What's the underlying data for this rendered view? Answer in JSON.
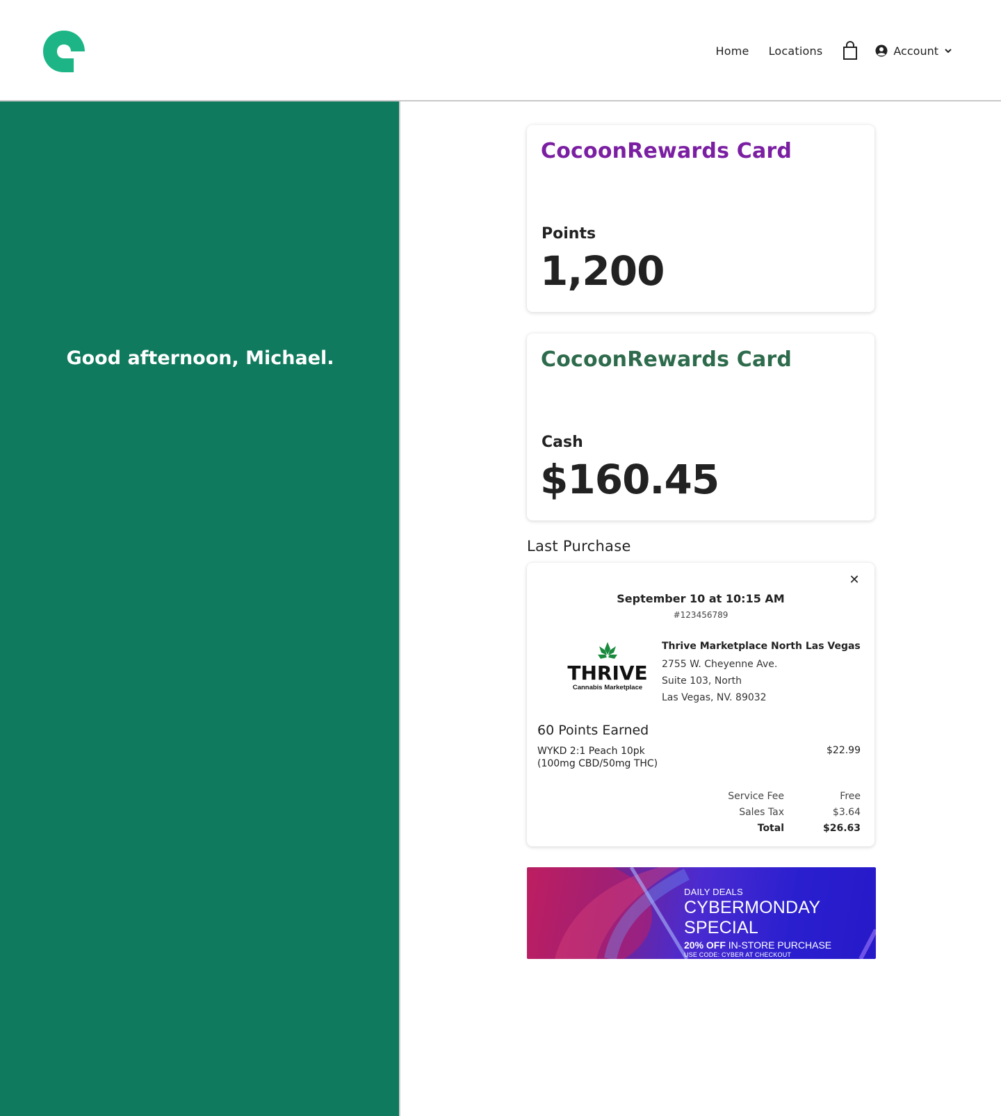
{
  "header": {
    "nav": [
      {
        "label": "Home"
      },
      {
        "label": "Locations"
      }
    ],
    "account_label": "Account",
    "icons": {
      "logo": "cocoon-logo",
      "cart": "shopping-bag-icon",
      "user": "user-circle-icon",
      "chevron": "chevron-down-icon"
    },
    "brand_color": "#1db585"
  },
  "sidebar": {
    "greeting": "Good afternoon, Michael.",
    "background": "#0f7a5d"
  },
  "cards": [
    {
      "title": "CocoonRewards Card",
      "title_color": "#7b1fa2",
      "metric_label": "Points",
      "metric_value": "1,200"
    },
    {
      "title": "CocoonRewards Card",
      "title_color": "#2e6b4c",
      "metric_label": "Cash",
      "metric_value": "$160.45"
    }
  ],
  "last_purchase": {
    "heading": "Last Purchase",
    "date": "September 10 at 10:15 AM",
    "order_number": "#123456789",
    "store": {
      "logo_text": "THRIVE",
      "logo_subtext": "Cannabis Marketplace",
      "name": "Thrive Marketplace North Las Vegas",
      "address_lines": [
        "2755 W. Cheyenne Ave.",
        "Suite 103, North",
        "Las Vegas, NV. 89032"
      ]
    },
    "points_earned": "60 Points Earned",
    "item": {
      "name": "WYKD 2:1 Peach 10pk (100mg CBD/50mg THC)",
      "price": "$22.99"
    },
    "summary": [
      {
        "label": "Service Fee",
        "value": "Free"
      },
      {
        "label": "Sales Tax",
        "value": "$3.64"
      },
      {
        "label": "Total",
        "value": "$26.63"
      }
    ]
  },
  "promo": {
    "eyebrow": "DAILY DEALS",
    "headline": "CYBERMONDAY SPECIAL",
    "offer_bold": "20% OFF",
    "offer_rest": " IN-STORE PURCHASE",
    "code": "USE CODE: CYBER AT CHECKOUT"
  }
}
